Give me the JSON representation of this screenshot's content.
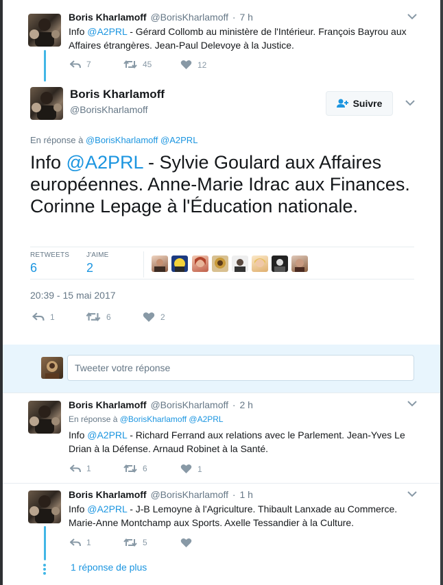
{
  "colors": {
    "link": "#1b95e0",
    "thread_line": "#41b6e6",
    "muted": "#657786",
    "action": "#8899a6"
  },
  "tweet1": {
    "name": "Boris Kharlamoff",
    "handle": "@BorisKharlamoff",
    "dot": "·",
    "time": "7 h",
    "text_prefix": "Info ",
    "mention": "@A2PRL",
    "text_rest": " - Gérard Collomb au ministère de l'Intérieur. François Bayrou aux Affaires étrangères. Jean-Paul Delevoye à la Justice.",
    "replies": "7",
    "retweets": "45",
    "likes": "12"
  },
  "main": {
    "name": "Boris Kharlamoff",
    "handle": "@BorisKharlamoff",
    "follow_label": "Suivre",
    "reply_prefix": "En réponse à ",
    "reply_to_1": "@BorisKharlamoff",
    "reply_to_2": "@A2PRL",
    "text_prefix": "Info ",
    "mention": "@A2PRL",
    "text_rest": " - Sylvie Goulard aux Affaires européennes. Anne-Marie Idrac aux Finances. Corinne Lepage à l'Éducation nationale.",
    "retweets_label": "RETWEETS",
    "retweets_count": "6",
    "likes_label": "J'AIME",
    "likes_count": "2",
    "timestamp": "20:39 - 15 mai 2017",
    "replies": "1",
    "retweets": "6",
    "likes": "2",
    "likers_count_avatars": 8
  },
  "reply_box": {
    "placeholder": "Tweeter votre réponse"
  },
  "tweet3": {
    "name": "Boris Kharlamoff",
    "handle": "@BorisKharlamoff",
    "dot": "·",
    "time": "2 h",
    "reply_prefix": "En réponse à ",
    "reply_to_1": "@BorisKharlamoff",
    "reply_to_2": "@A2PRL",
    "text_prefix": "Info ",
    "mention": "@A2PRL",
    "text_rest": " - Richard Ferrand aux relations avec le Parlement. Jean-Yves Le Drian à la Défense. Arnaud Robinet à la Santé.",
    "replies": "1",
    "retweets": "6",
    "likes": "1"
  },
  "tweet4": {
    "name": "Boris Kharlamoff",
    "handle": "@BorisKharlamoff",
    "dot": "·",
    "time": "1 h",
    "text_prefix": "Info ",
    "mention": "@A2PRL",
    "text_rest": " - J-B Lemoyne à l'Agriculture. Thibault Lanxade au Commerce. Marie-Anne Montchamp aux Sports. Axelle Tessandier à la Culture.",
    "replies": "1",
    "retweets": "5",
    "likes": ""
  },
  "more_replies": "1 réponse de plus"
}
